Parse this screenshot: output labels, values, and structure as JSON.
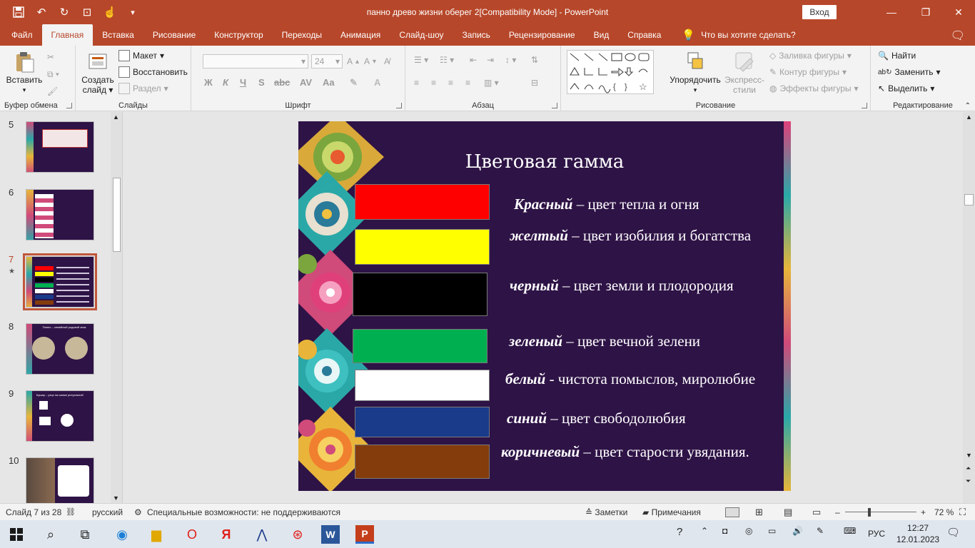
{
  "window": {
    "title": "панно древо жизни оберег 2[Compatibility Mode]  -  PowerPoint",
    "signin_label": "Вход",
    "accent": "#b7472a"
  },
  "tabs": [
    "Файл",
    "Главная",
    "Вставка",
    "Рисование",
    "Конструктор",
    "Переходы",
    "Анимация",
    "Слайд-шоу",
    "Запись",
    "Рецензирование",
    "Вид",
    "Справка"
  ],
  "tellme": "Что вы хотите сделать?",
  "ribbon": {
    "clipboard": {
      "paste": "Вставить",
      "label": "Буфер обмена"
    },
    "slides": {
      "new_slide_1": "Создать",
      "new_slide_2": "слайд",
      "layout": "Макет",
      "reset": "Восстановить",
      "section": "Раздел",
      "label": "Слайды"
    },
    "font": {
      "font_size": "24",
      "bold": "Ж",
      "italic": "К",
      "underline": "Ч",
      "strike": "S",
      "label": "Шрифт"
    },
    "paragraph": {
      "label": "Абзац"
    },
    "drawing": {
      "arrange": "Упорядочить",
      "quick_styles_1": "Экспресс-",
      "quick_styles_2": "стили",
      "fill": "Заливка фигуры",
      "outline": "Контур фигуры",
      "effects": "Эффекты фигуры",
      "label": "Рисование"
    },
    "editing": {
      "find": "Найти",
      "replace": "Заменить",
      "select": "Выделить",
      "label": "Редактирование"
    }
  },
  "thumbnails": [
    {
      "num": "5"
    },
    {
      "num": "6"
    },
    {
      "num": "7",
      "current": true,
      "star": "★"
    },
    {
      "num": "8",
      "text": "Панно – семейный родовой знак"
    },
    {
      "num": "9",
      "text": "Кушар – узор на шапке ритуальной"
    },
    {
      "num": "10"
    }
  ],
  "slide": {
    "title": "Цветовая гамма",
    "rows": [
      {
        "color": "#ff0000",
        "term": "Красный",
        "desc": " – цвет тепла и огня"
      },
      {
        "color": "#ffff00",
        "term": "желтый",
        "desc": " – цвет изобилия и богатства"
      },
      {
        "color": "#000000",
        "term": "черный",
        "desc": " – цвет земли и плодородия"
      },
      {
        "color": "#00b050",
        "term": "зеленый",
        "desc": " – цвет вечной зелени"
      },
      {
        "color": "#ffffff",
        "term": "белый",
        "desc": " - чистота помыслов, миролюбие"
      },
      {
        "color": "#1a3a8a",
        "term": "синий",
        "desc": " – цвет свободолюбия"
      },
      {
        "color": "#843c0c",
        "term": "коричневый",
        "desc": " – цвет старости увядания."
      }
    ]
  },
  "status": {
    "slide_counter": "Слайд 7 из 28",
    "language": "русский",
    "accessibility": "Специальные возможности: не поддерживаются",
    "notes": "Заметки",
    "comments": "Примечания",
    "zoom": "72 %"
  },
  "taskbar": {
    "lang": "РУС",
    "time": "12:27",
    "date": "12.01.2023"
  }
}
